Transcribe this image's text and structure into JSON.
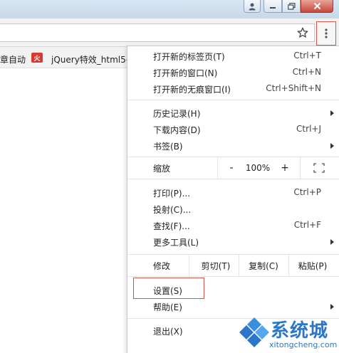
{
  "bookmarks": {
    "item1": "章自动",
    "item2_icon_text": "火",
    "item2": "jQuery特效_html5-"
  },
  "menu": {
    "items_top": [
      {
        "label": "打开新的标签页(T)",
        "shortcut": "Ctrl+T"
      },
      {
        "label": "打开新的窗口(N)",
        "shortcut": "Ctrl+N"
      },
      {
        "label": "打开新的无痕窗口(I)",
        "shortcut": "Ctrl+Shift+N"
      }
    ],
    "items_history": [
      {
        "label": "历史记录(H)",
        "shortcut": ""
      },
      {
        "label": "下载内容(D)",
        "shortcut": "Ctrl+J"
      },
      {
        "label": "书签(B)",
        "shortcut": ""
      }
    ],
    "zoom": {
      "label": "缩放",
      "minus": "-",
      "value": "100%",
      "plus": "+"
    },
    "items_tools": [
      {
        "label": "打印(P)...",
        "shortcut": "Ctrl+P"
      },
      {
        "label": "投射(C)...",
        "shortcut": ""
      },
      {
        "label": "查找(F)...",
        "shortcut": "Ctrl+F"
      },
      {
        "label": "更多工具(L)",
        "shortcut": ""
      }
    ],
    "edit": {
      "label": "修改",
      "cut": "剪切(T)",
      "copy": "复制(C)",
      "paste": "粘贴(P)"
    },
    "settings": "设置(S)",
    "help": "帮助(E)",
    "exit": "退出(X)"
  },
  "watermark": {
    "text": "系统城",
    "url": "xitongcheng.com"
  },
  "colors": {
    "highlight": "#d9534f",
    "watermark": "#2a77c9"
  }
}
